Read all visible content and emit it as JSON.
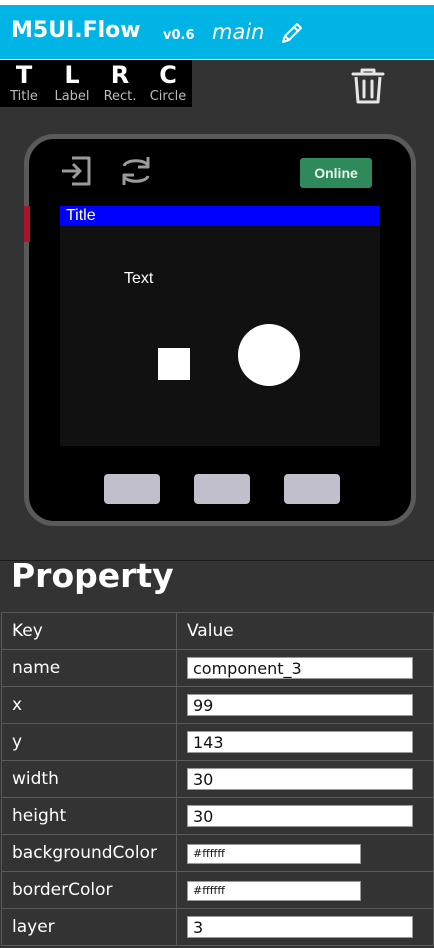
{
  "header": {
    "app_name": "M5UI.Flow",
    "version": "v0.6",
    "flow_name": "main",
    "edit_icon": "pencil-icon",
    "color": "#00b4e6"
  },
  "toolbar": {
    "tools": [
      {
        "letter": "T",
        "name": "Title"
      },
      {
        "letter": "L",
        "name": "Label"
      },
      {
        "letter": "R",
        "name": "Rect."
      },
      {
        "letter": "C",
        "name": "Circle"
      }
    ],
    "trash_icon": "trash-icon"
  },
  "device": {
    "icons": [
      "sign-in-icon",
      "sync-icon"
    ],
    "status": "Online",
    "status_color": "#2e8a5a",
    "screen": {
      "title": "Title",
      "title_color": "#0000ff",
      "label": "Text"
    }
  },
  "property": {
    "heading": "Property",
    "columns": [
      "Key",
      "Value"
    ],
    "rows": [
      {
        "key": "name",
        "value": "component_3"
      },
      {
        "key": "x",
        "value": "99"
      },
      {
        "key": "y",
        "value": "143"
      },
      {
        "key": "width",
        "value": "30"
      },
      {
        "key": "height",
        "value": "30"
      },
      {
        "key": "backgroundColor",
        "value": "#ffffff"
      },
      {
        "key": "borderColor",
        "value": "#ffffff"
      },
      {
        "key": "layer",
        "value": "3"
      }
    ]
  }
}
